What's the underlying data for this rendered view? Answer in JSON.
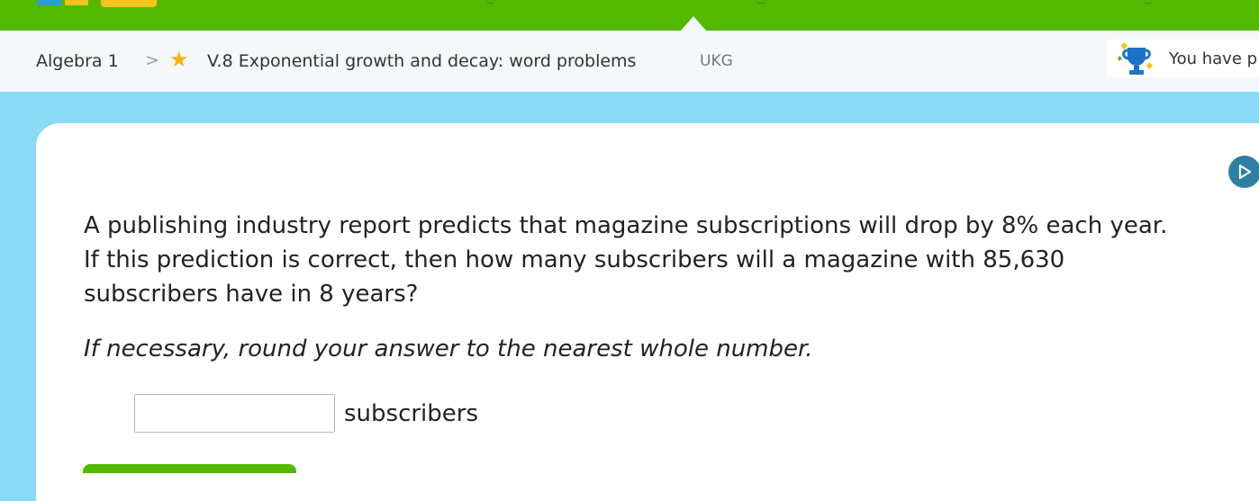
{
  "breadcrumb": {
    "subject": "Algebra 1",
    "separator": ">",
    "skill_title": "V.8 Exponential growth and decay: word problems",
    "skill_code": "UKG"
  },
  "award": {
    "text": "You have p",
    "icon": "trophy-icon"
  },
  "question": {
    "line1": "A publishing industry report predicts that magazine subscriptions will drop by 8% each year.",
    "line2": "If this prediction is correct, then how many subscribers will a magazine with 85,630",
    "line3": "subscribers have in 8 years?",
    "instruction": "If necessary, round your answer to the nearest whole number."
  },
  "answer": {
    "value": "",
    "unit": "subscribers"
  },
  "colors": {
    "topbar": "#52b800",
    "page_bg": "#8ad9f5",
    "star": "#f7b500",
    "play_button": "#2f7fa3"
  }
}
